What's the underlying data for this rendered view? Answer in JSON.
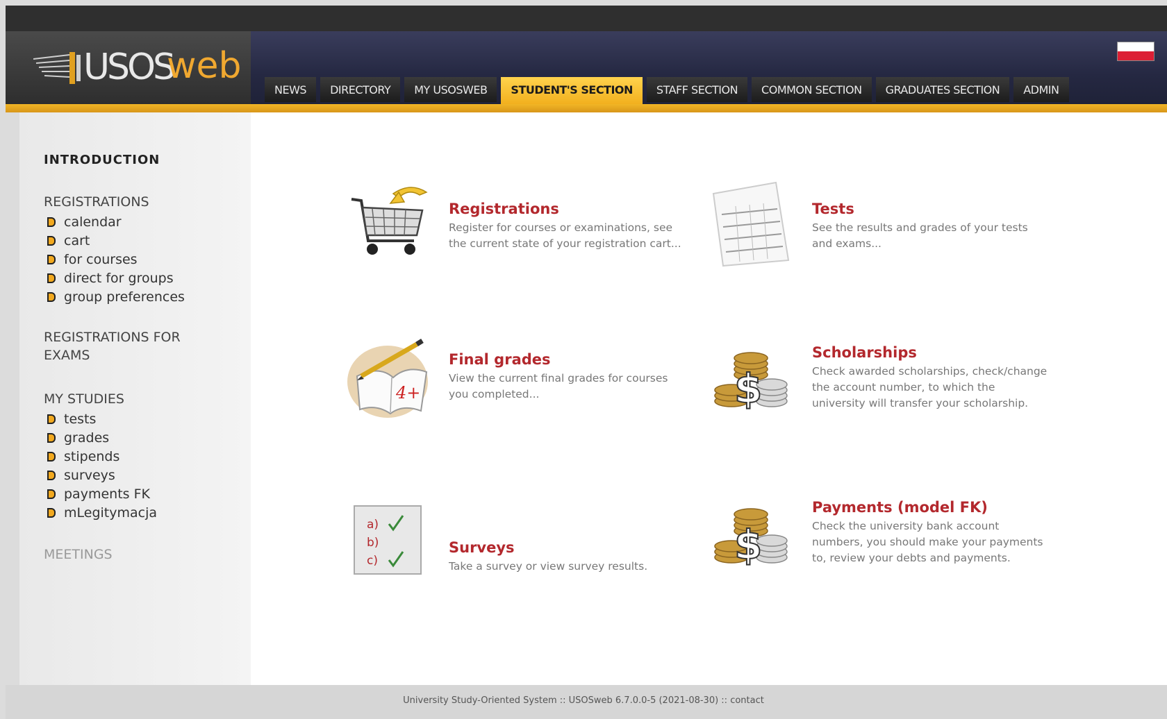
{
  "header": {
    "logo_text_a": "USOS",
    "logo_text_b": "web",
    "tabs": [
      {
        "label": "NEWS"
      },
      {
        "label": "DIRECTORY"
      },
      {
        "label": "MY USOSWEB"
      },
      {
        "label": "STUDENT'S SECTION",
        "active": true
      },
      {
        "label": "STAFF SECTION"
      },
      {
        "label": "COMMON SECTION"
      },
      {
        "label": "GRADUATES SECTION"
      },
      {
        "label": "ADMIN"
      }
    ],
    "language_flag": "polish-flag-icon"
  },
  "sidebar": {
    "introduction": "INTRODUCTION",
    "registrations": "REGISTRATIONS",
    "registrations_items": [
      "calendar",
      "cart",
      "for courses",
      "direct for groups",
      "group preferences"
    ],
    "registrations_for_exams_1": "REGISTRATIONS FOR",
    "registrations_for_exams_2": "EXAMS",
    "my_studies": "MY STUDIES",
    "my_studies_items": [
      "tests",
      "grades",
      "stipends",
      "surveys",
      "payments FK",
      "mLegitymacja"
    ],
    "meetings": "MEETINGS"
  },
  "tiles": [
    {
      "title": "Registrations",
      "desc": "Register for courses or examinations, see the current state of your registration cart...",
      "icon": "shopping-cart-icon"
    },
    {
      "title": "Tests",
      "desc": "See the results and grades of your tests and exams...",
      "icon": "test-sheet-icon"
    },
    {
      "title": "Final grades",
      "desc": "View the current final grades for courses you completed...",
      "icon": "grade-book-icon"
    },
    {
      "title": "Scholarships",
      "desc": "Check awarded scholarships, check/change the account number, to which the university will transfer your scholarship.",
      "icon": "dollar-coins-icon"
    },
    {
      "title": "Surveys",
      "desc": "Take a survey or view survey results.",
      "icon": "survey-checklist-icon"
    },
    {
      "title": "Payments (model FK)",
      "desc": "Check the university bank account numbers, you should make your payments to, review your debts and payments.",
      "icon": "dollar-coins-icon"
    }
  ],
  "survey_icon_text": [
    "a)",
    "b)",
    "c)"
  ],
  "grade_icon_text": "4+",
  "footer": "University Study-Oriented System :: USOSweb 6.7.0.0-5 (2021-08-30) :: contact",
  "colors": {
    "accent": "#f2b01e",
    "title_red": "#b3282d",
    "header_dark": "#252842"
  }
}
